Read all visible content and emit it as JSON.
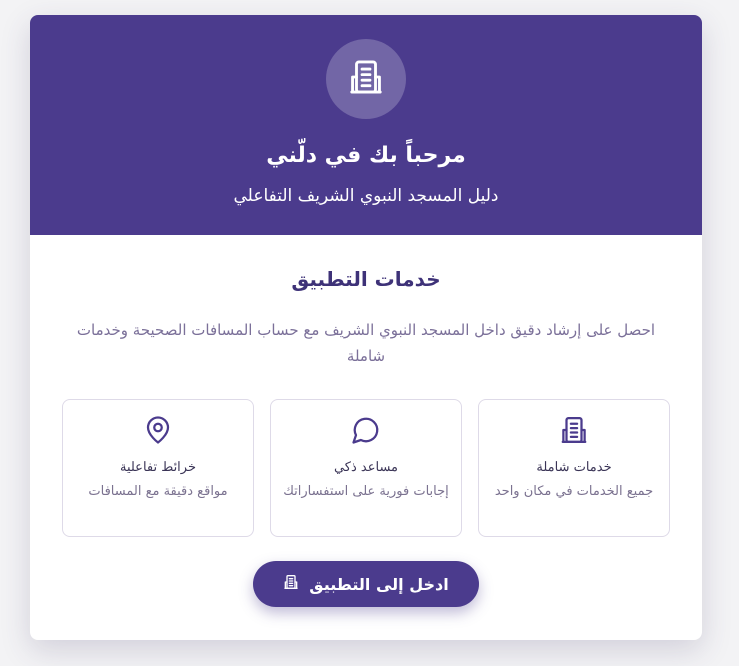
{
  "header": {
    "title": "مرحباً بك في دلّني",
    "subtitle": "دليل المسجد النبوي الشريف التفاعلي",
    "logo_icon": "building-icon"
  },
  "services": {
    "title": "خدمات التطبيق",
    "description": "احصل على إرشاد دقيق داخل المسجد النبوي الشريف مع حساب المسافات الصحيحة وخدمات شاملة"
  },
  "features": [
    {
      "icon": "building-icon",
      "title": "خدمات شاملة",
      "description": "جميع الخدمات في مكان واحد"
    },
    {
      "icon": "chat-bubble-icon",
      "title": "مساعد ذكي",
      "description": "إجابات فورية على استفساراتك"
    },
    {
      "icon": "map-pin-icon",
      "title": "خرائط تفاعلية",
      "description": "مواقع دقيقة مع المسافات"
    }
  ],
  "enter_button": {
    "label": "ادخل إلى التطبيق",
    "icon": "building-icon"
  },
  "colors": {
    "primary": "#4b3b8d",
    "background": "#f3f3f5",
    "card": "#ffffff",
    "muted_text": "#7b7099"
  }
}
